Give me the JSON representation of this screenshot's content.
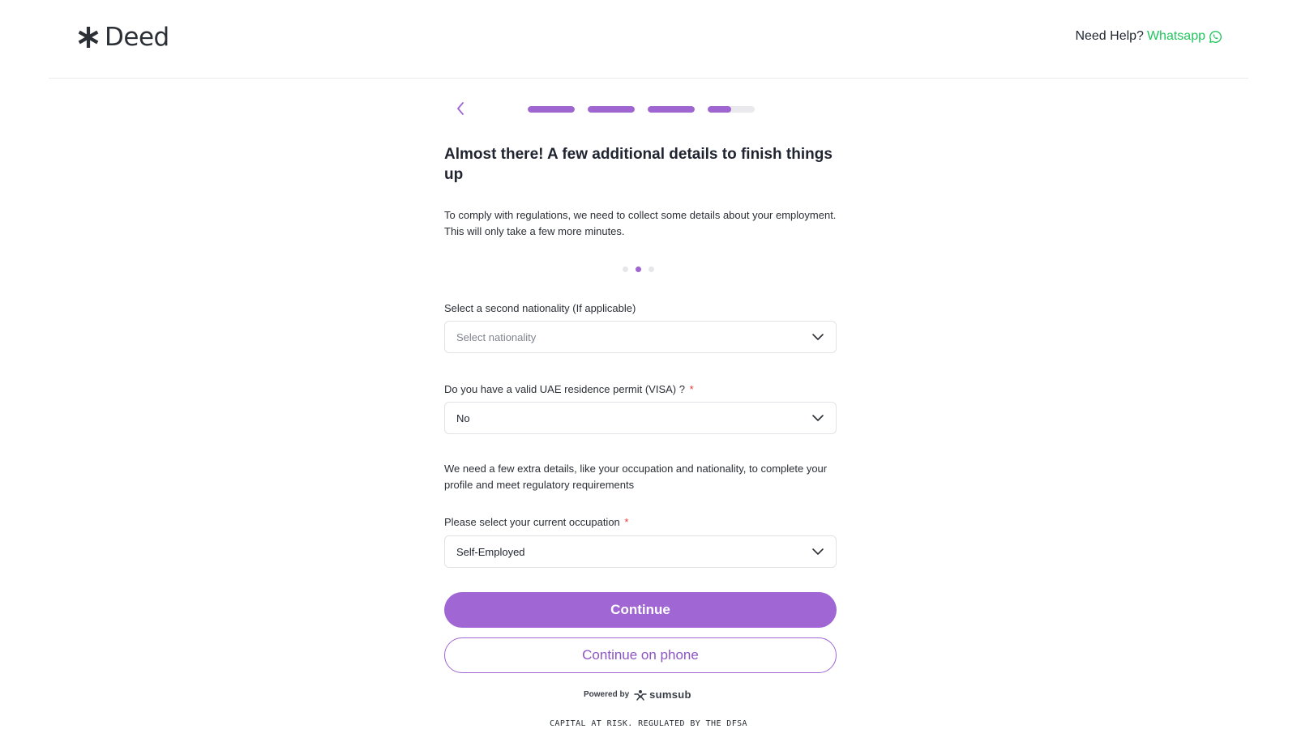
{
  "header": {
    "brand": "Deed",
    "help_label": "Need Help?",
    "help_link": "Whatsapp"
  },
  "progress": {
    "steps_total": 4,
    "steps": [
      1,
      1,
      1,
      0.5
    ],
    "accent_color": "#9f66d2"
  },
  "page": {
    "title": "Almost there! A few additional details to finish things up",
    "intro": "To comply with regulations, we need to collect some details about your employment. This will only take a few more minutes.",
    "carousel_dots_total": 3,
    "carousel_active_index": 1
  },
  "form": {
    "second_nationality": {
      "label": "Select a second nationality (If applicable)",
      "placeholder": "Select nationality"
    },
    "uae_permit": {
      "label": "Do you have a valid UAE residence permit (VISA) ?",
      "required_mark": "*",
      "value": "No"
    },
    "note": "We need a few extra details, like your occupation and nationality, to complete your profile and meet regulatory requirements",
    "occupation": {
      "label": "Please select your current occupation",
      "required_mark": "*",
      "value": "Self-Employed"
    }
  },
  "actions": {
    "continue_label": "Continue",
    "continue_phone_label": "Continue on phone"
  },
  "footer": {
    "powered_by": "Powered by",
    "provider": "sumsub",
    "disclaimer": "CAPITAL AT RISK. REGULATED BY THE DFSA"
  },
  "icons": {
    "logo": "asterisk-logo-icon",
    "whatsapp": "whatsapp-icon",
    "back": "chevron-left-icon",
    "dropdown": "chevron-down-icon",
    "provider": "sumsub-logo-icon"
  },
  "colors": {
    "accent": "#a066d3",
    "whatsapp": "#22c55e",
    "required": "#e53935"
  }
}
